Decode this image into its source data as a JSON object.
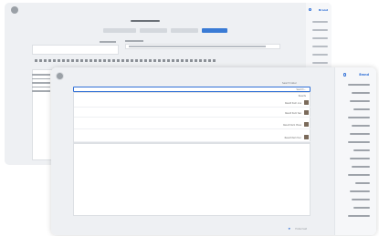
{
  "back_panel": {
    "brand": "Brand",
    "title": "Page title",
    "tabs": [
      "Tab one",
      "Tab two",
      "Tab three",
      "Tab four"
    ]
  },
  "front_panel": {
    "brand": "Brand",
    "search": {
      "label": "Search label",
      "placeholder": "Search..."
    },
    "results_header": "Results",
    "results": [
      "Result item one",
      "Result item two",
      "Result item three",
      "Result item four"
    ],
    "footer": "Footer text"
  },
  "colors": {
    "accent": "#2f6fd6",
    "active_tab": "#3a7bd5",
    "panel_bg": "#eef0f3"
  }
}
